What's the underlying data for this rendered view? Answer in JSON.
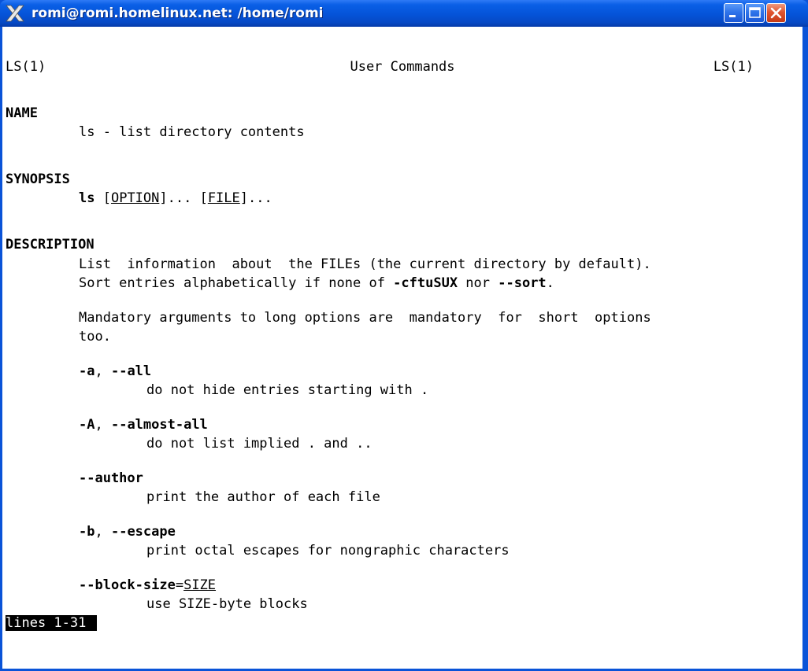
{
  "window": {
    "title": "romi@romi.homelinux.net: /home/romi",
    "buttons": {
      "minimize": "minimize-icon",
      "maximize": "maximize-icon",
      "close": "close-icon"
    },
    "colors": {
      "titlebar": "#0553d8",
      "close": "#e0552f",
      "background": "#ffffff",
      "text": "#000000"
    }
  },
  "man": {
    "header_left": "LS(1)",
    "header_center": "User Commands",
    "header_right": "LS(1)",
    "sections": {
      "name_heading": "NAME",
      "name_text": "ls - list directory contents",
      "synopsis_heading": "SYNOPSIS",
      "synopsis_cmd": "ls",
      "synopsis_opt_open": " [",
      "synopsis_option": "OPTION",
      "synopsis_mid": "]... [",
      "synopsis_file": "FILE",
      "synopsis_end": "]...",
      "description_heading": "DESCRIPTION",
      "desc_line1": "List  information  about  the FILEs (the current directory by default).",
      "desc_line2_a": "Sort entries alphabetically if none of ",
      "desc_line2_b": "-cftuSUX",
      "desc_line2_c": " nor ",
      "desc_line2_d": "--sort",
      "desc_line2_e": ".",
      "mandatory_line1": "Mandatory arguments to long options are  mandatory  for  short  options",
      "mandatory_line2": "too."
    },
    "options": [
      {
        "flag_a": "-a",
        "sep": ", ",
        "flag_b": "--all",
        "desc": "do not hide entries starting with ."
      },
      {
        "flag_a": "-A",
        "sep": ", ",
        "flag_b": "--almost-all",
        "desc": "do not list implied . and .."
      },
      {
        "flag_a": "--author",
        "desc": "print the author of each file"
      },
      {
        "flag_a": "-b",
        "sep": ", ",
        "flag_b": "--escape",
        "desc": "print octal escapes for nongraphic characters"
      },
      {
        "flag_a": "--block-size",
        "eq": "=",
        "arg": "SIZE",
        "desc": "use SIZE-byte blocks"
      }
    ],
    "status_line": "lines 1-31"
  }
}
